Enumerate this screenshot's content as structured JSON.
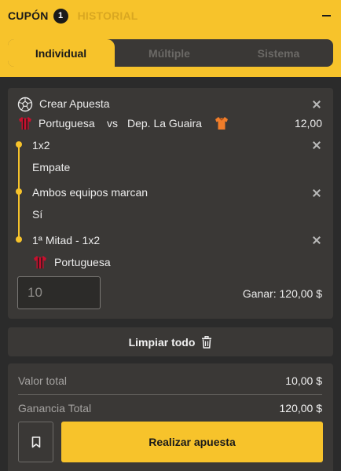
{
  "header": {
    "coupon_tab": "CUPÓN",
    "coupon_count": "1",
    "history_tab": "HISTORIAL"
  },
  "bet_types": [
    {
      "label": "Individual",
      "active": true
    },
    {
      "label": "Múltiple",
      "active": false
    },
    {
      "label": "Sistema",
      "active": false
    }
  ],
  "bet": {
    "title": "Crear Apuesta",
    "home_team": "Portuguesa",
    "vs": "vs",
    "away_team": "Dep. La Guaira",
    "odds": "12,00",
    "selections": [
      {
        "market": "1x2",
        "pick": "Empate"
      },
      {
        "market": "Ambos equipos marcan",
        "pick": "Sí"
      },
      {
        "market": "1ª Mitad - 1x2",
        "pick": "Portuguesa"
      }
    ],
    "stake_value": "10",
    "win_label": "Ganar: 120,00 $"
  },
  "clear_all_label": "Limpiar todo",
  "summary": {
    "total_label": "Valor total",
    "total_value": "10,00 $",
    "gain_label": "Ganancia Total",
    "gain_value": "120,00 $",
    "place_bet_label": "Realizar apuesta"
  },
  "colors": {
    "accent": "#f7c32b",
    "card_bg": "#3a3836",
    "page_bg": "#2b2b2b",
    "home_shirt": "#c8102e",
    "away_shirt": "#f07d2a"
  }
}
